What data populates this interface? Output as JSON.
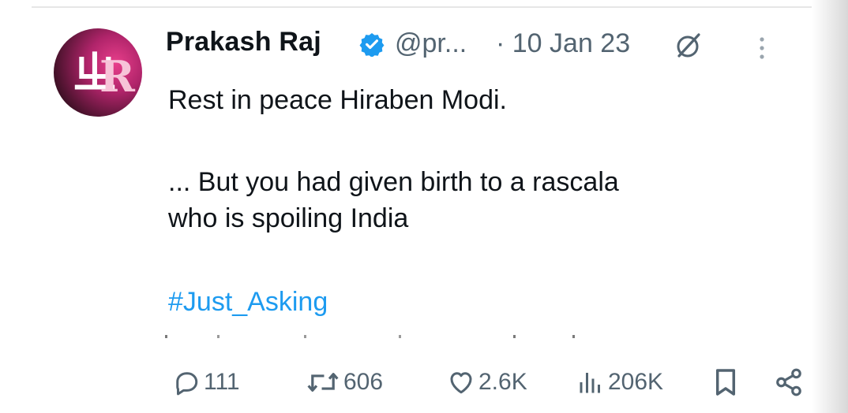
{
  "tweet": {
    "author_name": "Prakash Raj",
    "handle": "@pr...",
    "date": "· 10 Jan 23",
    "lines": [
      "Rest in peace Hiraben Modi.",
      "",
      "... But you had given birth to a rascala",
      "who is spoiling India"
    ],
    "hashtag": "#Just_Asking"
  },
  "actions": {
    "replies": "111",
    "reposts": "606",
    "likes": "2.6K",
    "views": "206K"
  },
  "icons": {
    "avatar": "avatar-logo",
    "verified": "verified-badge-icon",
    "grok": "grok-icon",
    "more": "more-vertical-icon",
    "reply": "reply-icon",
    "repost": "repost-icon",
    "like": "heart-icon",
    "views": "views-bar-icon",
    "bookmark": "bookmark-icon",
    "share": "share-icon"
  },
  "colors": {
    "text": "#0f1419",
    "muted": "#536471",
    "link": "#1d9bf0",
    "verified": "#1d9bf0",
    "avatar_accent": "#e83f8b"
  }
}
